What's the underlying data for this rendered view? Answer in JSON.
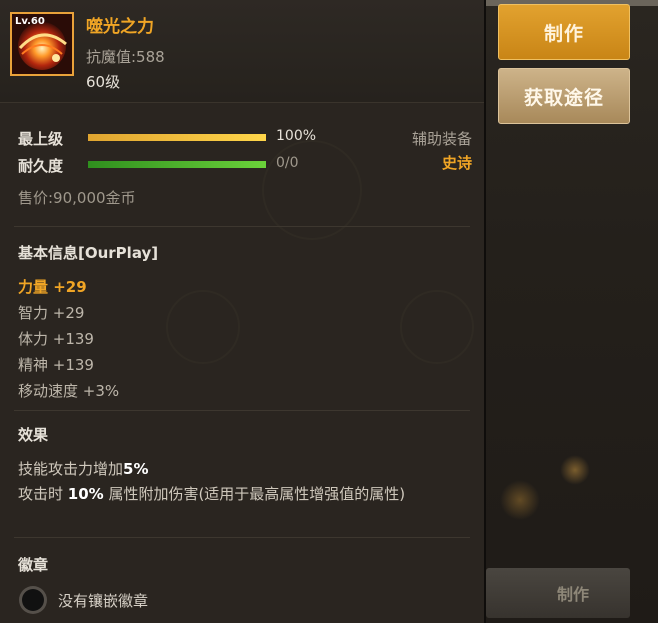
{
  "item": {
    "level_badge": "Lv.60",
    "name": "噬光之力",
    "magic_resist": "抗魔值:588",
    "level_text": "60级"
  },
  "buttons": {
    "make": "制作",
    "source": "获取途径",
    "bottom_make": "制作"
  },
  "bars": {
    "upgrade_label": "最上级",
    "upgrade_value": "100%",
    "upgrade_fraction": 1.0,
    "durability_label": "耐久度",
    "durability_value": "0/0",
    "durability_fraction": 1.0
  },
  "type_label": "辅助装备",
  "grade_label": "史诗",
  "price": "售价:90,000金币",
  "basic_info": {
    "title": "基本信息[OurPlay]",
    "stats": [
      "力量 +29",
      "智力 +29",
      "体力 +139",
      "精神 +139",
      "移动速度 +3%"
    ]
  },
  "effects": {
    "title": "效果",
    "line1_pre": "技能攻击力增加",
    "line1_val": "5%",
    "line2_pre": "攻击时 ",
    "line2_val": "10%",
    "line2_post": " 属性附加伤害(适用于最高属性增强值的属性)"
  },
  "emblem": {
    "title": "徽章",
    "empty_text": "没有镶嵌徽章"
  },
  "colors": {
    "gold": "#f0a525",
    "panel": "#2a2520",
    "make_button": "#d4921f",
    "source_button": "#b89a6c"
  }
}
